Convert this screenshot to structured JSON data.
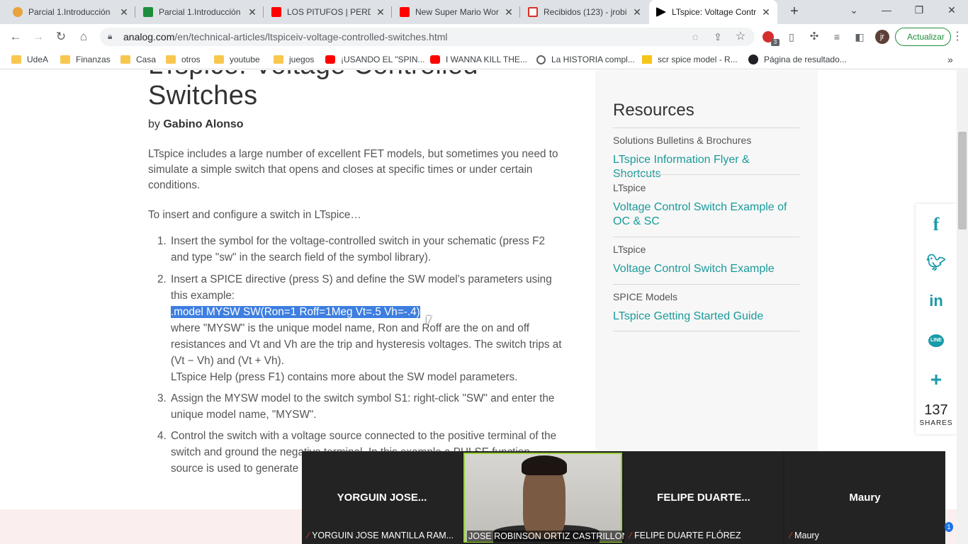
{
  "tabs": [
    {
      "title": "Parcial 1.Introducción",
      "icon": "recording-icon",
      "color": "#e8a33b"
    },
    {
      "title": "Parcial 1.Introducción",
      "icon": "classroom-icon",
      "color": "#1e8e3e"
    },
    {
      "title": "LOS PITUFOS | PERDÓ",
      "icon": "youtube-icon",
      "color": "#ff0000"
    },
    {
      "title": "New Super Mario Wor",
      "icon": "youtube-icon",
      "color": "#ff0000"
    },
    {
      "title": "Recibidos (123) - jrobi",
      "icon": "gmail-icon",
      "color": "#d93025"
    },
    {
      "title": "LTspice: Voltage Contr",
      "icon": "play-icon",
      "color": "#000000"
    }
  ],
  "toolbar": {
    "url_host": "analog.com",
    "url_path": "/en/technical-articles/ltspiceiv-voltage-controlled-switches.html",
    "update_label": "Actualizar",
    "avatar_letter": "jr",
    "ext_badge": "3"
  },
  "bookmarks": [
    {
      "label": "UdeA",
      "type": "folder"
    },
    {
      "label": "Finanzas",
      "type": "folder"
    },
    {
      "label": "Casa",
      "type": "folder"
    },
    {
      "label": "otros",
      "type": "folder"
    },
    {
      "label": "youtube",
      "type": "folder"
    },
    {
      "label": "juegos",
      "type": "folder"
    },
    {
      "label": "¡USANDO EL \"SPIN...",
      "type": "youtube"
    },
    {
      "label": "I WANNA KILL THE...",
      "type": "youtube"
    },
    {
      "label": "La HISTORIA compl...",
      "type": "globe"
    },
    {
      "label": "scr spice model - R...",
      "type": "st"
    },
    {
      "label": "Página de resultado...",
      "type": "search"
    }
  ],
  "article": {
    "title_line2": "Switches",
    "by": "by",
    "author": "Gabino Alonso",
    "intro": "LTspice includes a large number of excellent FET models, but sometimes you need to simulate a simple switch that opens and closes at specific times or under certain conditions.",
    "lead": "To insert and configure a switch in LTspice…",
    "step1": "Insert the symbol for the voltage-controlled switch in your schematic (press F2 and type \"sw\" in the search field of the symbol library).",
    "step2a": "Insert a SPICE directive (press S) and define the SW model's parameters using this example:",
    "step2_code": ".model MYSW SW(Ron=1 Roff=1Meg Vt=.5 Vh=-.4)",
    "step2b": "where \"MYSW\" is the unique model name, Ron and Roff are the on and off resistances and Vt and Vh are the trip and hysteresis voltages. The switch trips at (Vt − Vh) and (Vt + Vh).",
    "step2c": "LTspice Help (press F1) contains more about the SW model parameters.",
    "step3": "Assign the MYSW model to the switch symbol S1: right-click \"SW\" and enter the unique model name, \"MYSW\".",
    "step4": "Control the switch with a voltage source connected to the positive terminal of the switch and ground the negative terminal. In this example a PULSE function source is used to generate",
    "nums": [
      "1.",
      "2.",
      "3.",
      "4."
    ]
  },
  "resources": {
    "title": "Resources",
    "items": [
      {
        "category": "Solutions Bulletins & Brochures",
        "link": "LTspice Information Flyer & Shortcuts"
      },
      {
        "category": "LTspice",
        "link": "Voltage Control Switch Example of OC & SC"
      },
      {
        "category": "LTspice",
        "link": "Voltage Control Switch Example"
      },
      {
        "category": "SPICE Models",
        "link": "LTspice Getting Started Guide"
      }
    ]
  },
  "share": {
    "count": "137",
    "label": "SHARES",
    "icons": [
      "facebook-icon",
      "twitter-icon",
      "linkedin-icon",
      "line-icon",
      "plus-icon"
    ]
  },
  "meeting": {
    "participants": [
      {
        "big_name": "YORGUIN JOSE...",
        "label": "YORGUIN JOSE MANTILLA RAM...",
        "muted": true
      },
      {
        "big_name": "",
        "label": "JOSE ROBINSON ORTIZ CASTRILLON",
        "muted": false
      },
      {
        "big_name": "FELIPE DUARTE...",
        "label": "FELIPE DUARTE FLÓREZ",
        "muted": true
      },
      {
        "big_name": "Maury",
        "label": "Maury",
        "muted": true
      }
    ],
    "corner_badge": "1"
  }
}
